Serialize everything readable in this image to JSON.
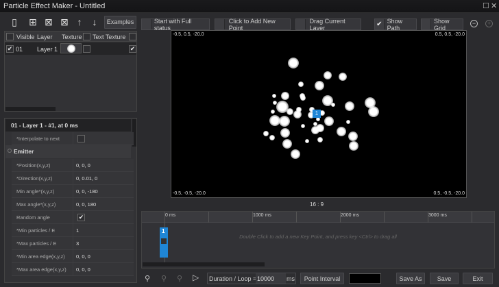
{
  "window": {
    "title": "Particle Effect Maker - Untitled",
    "maximize_icon": "maximize-icon",
    "close_icon": "close-icon"
  },
  "toolbar": {
    "icons": [
      "open-book-icon",
      "add-layer-icon",
      "delete-layer-icon",
      "delete-all-layers-icon",
      "move-up-icon",
      "move-down-icon"
    ],
    "examples_label": "Examples"
  },
  "layer_table": {
    "headers": {
      "visible": "Visible",
      "layer": "Layer",
      "texture": "Texture",
      "text_texture": "Text Texture"
    },
    "rows": [
      {
        "visible": true,
        "id": "01",
        "name": "Layer 1",
        "text_texture": false,
        "last": true
      }
    ]
  },
  "properties": {
    "header": "01 - Layer 1 - #1, at 0 ms",
    "interpolate_label": "*Interpolate to next",
    "interpolate": false,
    "section": "Emitter",
    "rows": [
      {
        "key": "*Position(x,y,z)",
        "value": "0, 0, 0"
      },
      {
        "key": "*Direction(x,y,z)",
        "value": "0, 0.01, 0"
      },
      {
        "key": "Min angle*(x,y,z)",
        "value": "0, 0, -180"
      },
      {
        "key": "Max angle*(x,y,z)",
        "value": "0, 0, 180"
      },
      {
        "key": "Random angle",
        "value": "✔"
      },
      {
        "key": "*Min particles / E",
        "value": "1"
      },
      {
        "key": "*Max particles / E",
        "value": "3"
      },
      {
        "key": "*Min area edge(x,y,z)",
        "value": "0, 0, 0"
      },
      {
        "key": "*Max area edge(x,y,z)",
        "value": "0, 0, 0"
      }
    ]
  },
  "options": {
    "start_full": "Start with Full status",
    "click_add": "Click to Add New Point",
    "drag_layer": "Drag Current Layer",
    "show_path": "Show Path",
    "show_path_checked": true,
    "show_grid": "Show Grid",
    "zoom_out_icon": "zoom-out-icon",
    "zoom_in_icon": "zoom-in-icon"
  },
  "canvas": {
    "top_left": "-0.5, 0.5, -20.0",
    "top_right": "0.5, 0.5, -20.0",
    "bottom_left": "-0.5, -0.5, -20.0",
    "bottom_right": "0.5, -0.5, -20.0",
    "marker": "1",
    "aspect": "16 : 9"
  },
  "timeline": {
    "ticks": [
      "0 ms",
      "1000 ms",
      "2000 ms",
      "3000 ms"
    ],
    "hint": "Double Click to add a new Key Point, and press key <Ctrl> to drag all",
    "keypoint": "1"
  },
  "bottom": {
    "duration_label": "Duration / Loop =",
    "duration_value": "10000",
    "unit": "ms",
    "point_interval": "Point Interval",
    "save_as": "Save As",
    "save": "Save",
    "exit": "Exit",
    "color_swatch": "#000000"
  }
}
